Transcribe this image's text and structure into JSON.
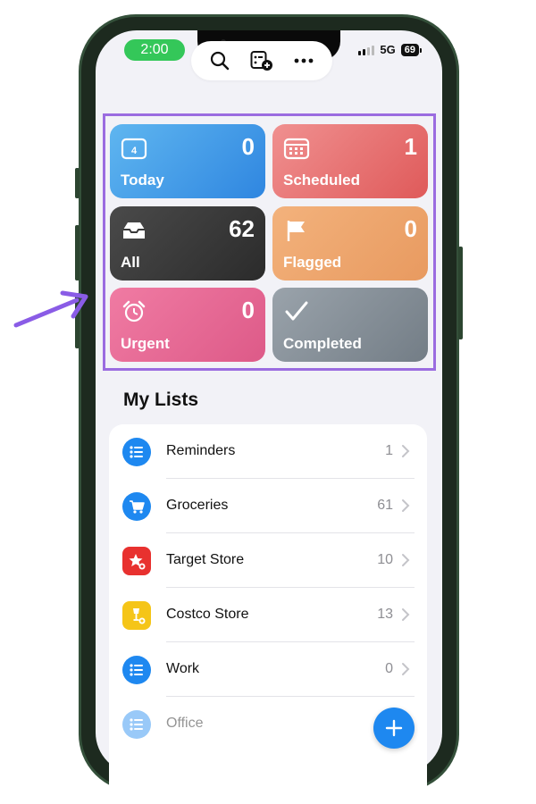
{
  "status_bar": {
    "time": "2:00",
    "network": "5G",
    "battery": "69"
  },
  "toolbar": {
    "icons": [
      "search-icon",
      "add-list-icon",
      "more-icon"
    ]
  },
  "smart_lists": [
    {
      "label": "Today",
      "count": "0",
      "icon": "calendar-today-icon",
      "color": "#3f9be8"
    },
    {
      "label": "Scheduled",
      "count": "1",
      "icon": "calendar-icon",
      "color": "#e46868"
    },
    {
      "label": "All",
      "count": "62",
      "icon": "tray-icon",
      "color": "#3a3a3a"
    },
    {
      "label": "Flagged",
      "count": "0",
      "icon": "flag-icon",
      "color": "#eea66e"
    },
    {
      "label": "Urgent",
      "count": "0",
      "icon": "alarm-icon",
      "color": "#e66b96"
    },
    {
      "label": "Completed",
      "count": "",
      "icon": "checkmark-icon",
      "color": "#868f98"
    }
  ],
  "today_date": "4",
  "my_lists": {
    "title": "My Lists",
    "items": [
      {
        "name": "Reminders",
        "count": "1",
        "icon": "list-icon",
        "color": "#1e88f0"
      },
      {
        "name": "Groceries",
        "count": "61",
        "icon": "cart-icon",
        "color": "#1e88f0"
      },
      {
        "name": "Target Store",
        "count": "10",
        "icon": "star-icon",
        "color": "#e8312f"
      },
      {
        "name": "Costco Store",
        "count": "13",
        "icon": "tag-icon",
        "color": "#f5c518"
      },
      {
        "name": "Work",
        "count": "0",
        "icon": "list-icon",
        "color": "#1e88f0"
      },
      {
        "name": "Office",
        "count": "",
        "icon": "list-icon",
        "color": "#1e88f0"
      }
    ]
  },
  "colors": {
    "accent": "#1e88f0",
    "highlight_border": "#9b6ce0",
    "annotation_arrow": "#8a5ce6"
  }
}
